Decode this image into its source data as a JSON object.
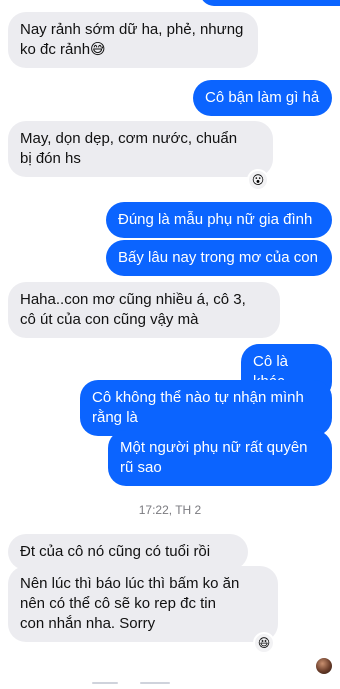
{
  "messages": [
    {
      "id": "m1",
      "dir": "in",
      "text": "Nay rảnh sớm dữ ha, phẻ, nhưng\nko đc rảnh😅"
    },
    {
      "id": "m2",
      "dir": "out",
      "text": "Cô bận làm gì hả"
    },
    {
      "id": "m3",
      "dir": "in",
      "text": "May, dọn dẹp, cơm nước, chuẩn\nbị đón hs"
    },
    {
      "id": "m4",
      "dir": "out",
      "text": "Đúng là mẫu phụ nữ gia đình"
    },
    {
      "id": "m5",
      "dir": "out",
      "text": "Bấy lâu nay trong mơ của con"
    },
    {
      "id": "m6",
      "dir": "in",
      "text": "Haha..con mơ cũng nhiều á, cô 3,\ncô út của con cũng vậy mà"
    },
    {
      "id": "m7",
      "dir": "out",
      "text": "Cô là khác"
    },
    {
      "id": "m8",
      "dir": "out",
      "text": "Cô không thể nào tự nhận mình\nrằng là"
    },
    {
      "id": "m9",
      "dir": "out",
      "text": "Một người phụ nữ rất quyên\nrũ sao"
    },
    {
      "id": "m10",
      "dir": "in",
      "text": "Đt của cô nó cũng có tuổi rồi"
    },
    {
      "id": "m11",
      "dir": "in",
      "text": "Nên lúc thì báo lúc thì bấm ko ăn\nnên có thể cô sẽ ko rep đc tin\ncon nhắn nha. Sorry"
    }
  ],
  "timestamp": "17:22, TH 2",
  "reactions": {
    "m3": "😮",
    "m11": "😆"
  },
  "colors": {
    "outgoing": "#0b64ff",
    "incoming": "#ececf0"
  }
}
